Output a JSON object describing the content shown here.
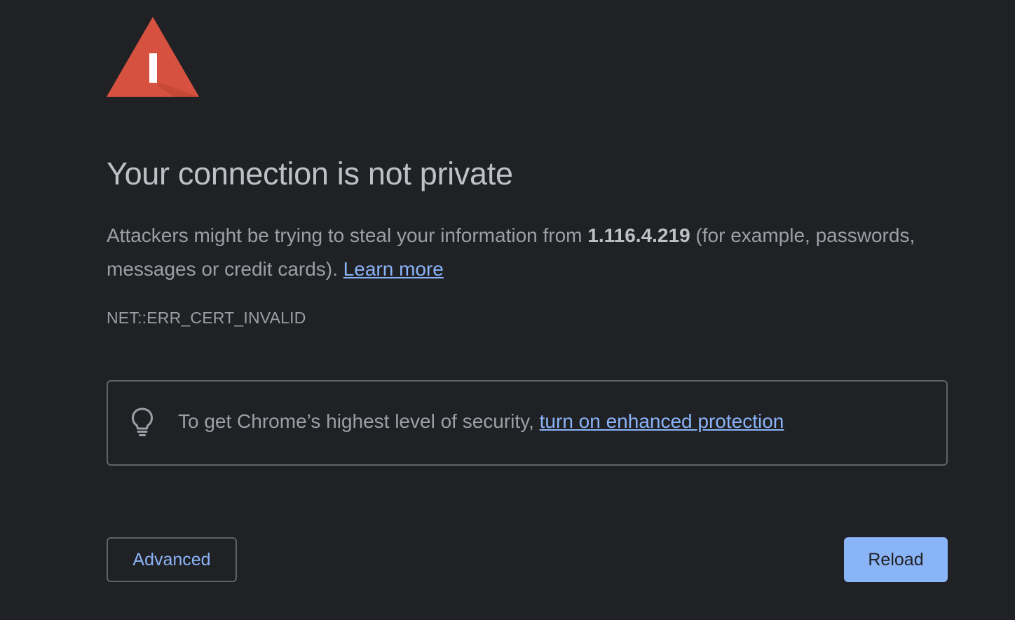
{
  "title": "Your connection is not private",
  "explanation": {
    "before_host": "Attackers might be trying to steal your information from ",
    "host": "1.116.4.219",
    "after_host": " (for example, passwords, messages or credit cards). ",
    "learn_more": "Learn more"
  },
  "error_code": "NET::ERR_CERT_INVALID",
  "promo": {
    "icon": "lightbulb-icon",
    "text": "To get Chrome’s highest level of security, ",
    "link": "turn on enhanced protection"
  },
  "buttons": {
    "advanced": "Advanced",
    "reload": "Reload"
  },
  "icons": {
    "warning": "warning-triangle-icon"
  },
  "colors": {
    "background": "#202124",
    "warning_red": "#d75140",
    "link_blue": "#8ab4f8",
    "title_text": "#bdc1c6",
    "body_text": "#9aa0a6",
    "border": "#5f6368"
  }
}
